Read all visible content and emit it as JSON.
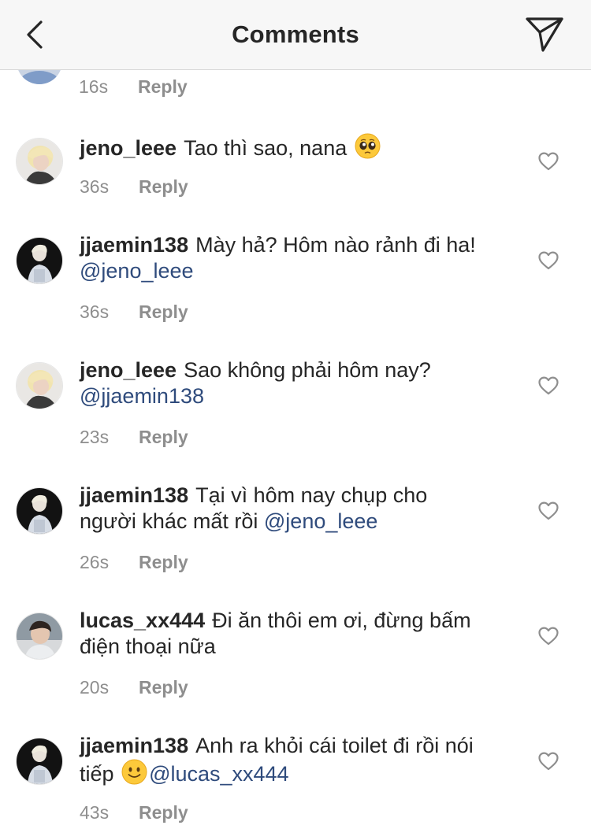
{
  "header": {
    "back_icon": "chevron-left-icon",
    "title": "Comments",
    "send_icon": "paper-plane-icon"
  },
  "partial_comment": {
    "time": "16s",
    "reply_label": "Reply"
  },
  "comments": [
    {
      "username": "jeno_leee",
      "text": "Tao thì sao, nana",
      "emoji": "pleading-face-emoji",
      "mention": "",
      "time": "36s",
      "reply_label": "Reply",
      "avatar": "avatar-jeno"
    },
    {
      "username": "jjaemin138",
      "text": "Mày hả? Hôm nào rảnh đi ha!",
      "mention": "@jeno_leee",
      "time": "36s",
      "reply_label": "Reply",
      "avatar": "avatar-jaemin"
    },
    {
      "username": "jeno_leee",
      "text": "Sao không phải hôm nay?",
      "mention": "@jjaemin138",
      "time": "23s",
      "reply_label": "Reply",
      "avatar": "avatar-jeno"
    },
    {
      "username": "jjaemin138",
      "text_line1": "Tại vì hôm nay chụp cho",
      "text_line2": "người khác mất rồi",
      "mention": "@jeno_leee",
      "time": "26s",
      "reply_label": "Reply",
      "avatar": "avatar-jaemin"
    },
    {
      "username": "lucas_xx444",
      "text_line1": "Đi ăn thôi em ơi, đừng bấm",
      "text_line2": "điện thoại nữa",
      "time": "20s",
      "reply_label": "Reply",
      "avatar": "avatar-lucas"
    },
    {
      "username": "jjaemin138",
      "text_line1": "Anh ra khỏi cái toilet đi rồi nói",
      "text_line2": "tiếp",
      "emoji": "slightly-smiling-face-emoji",
      "mention": "@lucas_xx444",
      "time": "43s",
      "reply_label": "Reply",
      "avatar": "avatar-jaemin"
    }
  ],
  "colors": {
    "text": "#262626",
    "secondary": "#8e8e8e",
    "mention": "#2f4b7c",
    "header_bg": "#f7f7f7"
  }
}
